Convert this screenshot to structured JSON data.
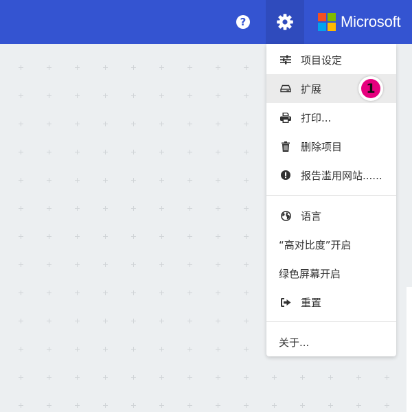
{
  "topbar": {
    "help_icon": "question-circle-icon",
    "help_glyph": "?",
    "settings_icon": "gear-icon",
    "brand": {
      "name": "Microsoft",
      "colors": [
        "#f25022",
        "#7fba00",
        "#00a4ef",
        "#ffb900"
      ]
    },
    "bar_color": "#3454d1"
  },
  "menu": {
    "items": [
      {
        "label": "项目设定",
        "icon": "sliders-icon"
      },
      {
        "label": "扩展",
        "icon": "drive-icon",
        "active": true
      },
      {
        "label": "打印...",
        "icon": "printer-icon"
      },
      {
        "label": "删除项目",
        "icon": "trash-icon"
      },
      {
        "label": "报告滥用网站......",
        "icon": "exclamation-circle-icon"
      },
      {
        "label": "语言",
        "icon": "globe-icon"
      },
      {
        "label": "“高对比度”开启"
      },
      {
        "label": "绿色屏幕开启"
      },
      {
        "label": "重置",
        "icon": "sign-out-icon"
      },
      {
        "label": "关于..."
      }
    ]
  },
  "tutorial_badge": {
    "number": "1",
    "color": "#e6007e"
  }
}
